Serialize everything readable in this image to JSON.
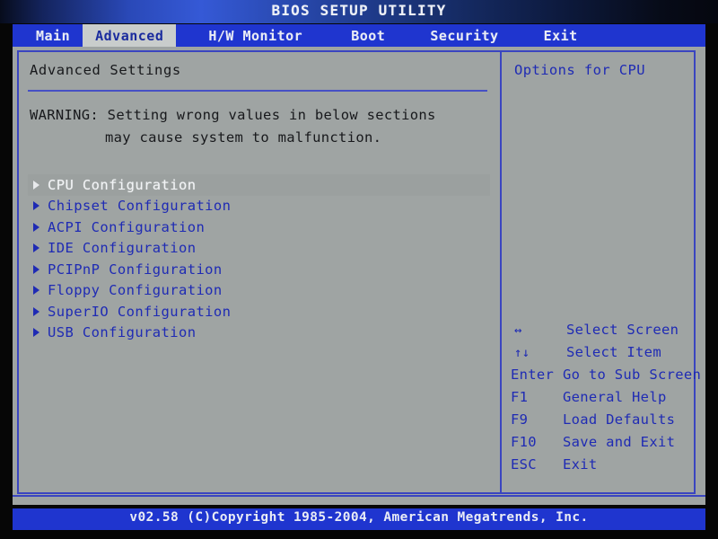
{
  "window": {
    "title": "BIOS SETUP UTILITY"
  },
  "menubar": {
    "tabs": [
      {
        "label": "Main",
        "active": false
      },
      {
        "label": "Advanced",
        "active": true
      },
      {
        "label": "H/W Monitor",
        "active": false
      },
      {
        "label": "Boot",
        "active": false
      },
      {
        "label": "Security",
        "active": false
      },
      {
        "label": "Exit",
        "active": false
      }
    ]
  },
  "left_pane": {
    "section_title": "Advanced Settings",
    "warning_line1": "WARNING: Setting wrong values in below sections",
    "warning_line2": "may cause system to malfunction.",
    "items": [
      {
        "label": "CPU Configuration",
        "selected": true
      },
      {
        "label": "Chipset Configuration",
        "selected": false
      },
      {
        "label": "ACPI Configuration",
        "selected": false
      },
      {
        "label": "IDE Configuration",
        "selected": false
      },
      {
        "label": "PCIPnP Configuration",
        "selected": false
      },
      {
        "label": "Floppy Configuration",
        "selected": false
      },
      {
        "label": "SuperIO Configuration",
        "selected": false
      },
      {
        "label": "USB Configuration",
        "selected": false
      }
    ]
  },
  "right_pane": {
    "help_title": "Options for CPU",
    "keys": [
      {
        "key": "↔",
        "desc": "Select Screen",
        "symbol": true
      },
      {
        "key": "↑↓",
        "desc": "Select Item",
        "symbol": true
      },
      {
        "key": "Enter",
        "desc": "Go to Sub Screen",
        "symbol": false
      },
      {
        "key": "F1",
        "desc": "General Help",
        "symbol": false
      },
      {
        "key": "F9",
        "desc": "Load Defaults",
        "symbol": false
      },
      {
        "key": "F10",
        "desc": "Save and Exit",
        "symbol": false
      },
      {
        "key": "ESC",
        "desc": "Exit",
        "symbol": false
      }
    ]
  },
  "footer": {
    "text": "v02.58 (C)Copyright 1985-2004, American Megatrends, Inc."
  },
  "colors": {
    "bar_blue": "#1f35cf",
    "text_blue": "#1f2bb4",
    "panel_gray": "#9fa4a3",
    "border_blue": "#3a45c0",
    "bezel_black": "#050505",
    "tab_active_bg": "#c9cdcc"
  }
}
